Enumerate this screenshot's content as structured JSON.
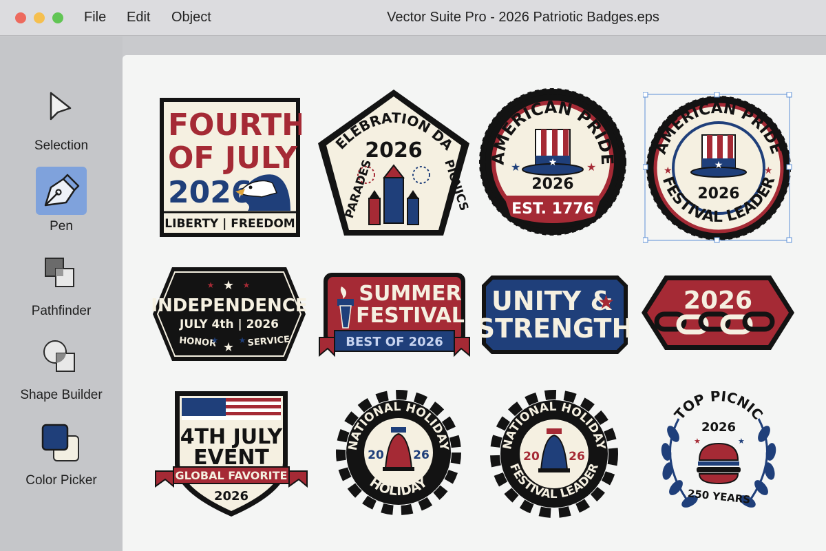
{
  "window": {
    "title": "Vector Suite Pro - 2026 Patriotic Badges.eps"
  },
  "menu": {
    "file": "File",
    "edit": "Edit",
    "object": "Object"
  },
  "tools": [
    {
      "label": "Selection",
      "icon": "arrow-cursor-icon",
      "active": false
    },
    {
      "label": "Pen",
      "icon": "pen-nib-icon",
      "active": true
    },
    {
      "label": "Pathfinder",
      "icon": "pathfinder-icon",
      "active": false
    },
    {
      "label": "Shape Builder",
      "icon": "shape-builder-icon",
      "active": false
    },
    {
      "label": "Color Picker",
      "icon": "color-swatch-icon",
      "active": false
    }
  ],
  "colors": {
    "red": "#a52a35",
    "navy": "#1f3f7a",
    "black": "#131313",
    "cream": "#f5f0e1",
    "selection": "#5b8fd6",
    "active_tool": "#7fa2dc"
  },
  "badges": {
    "b1": {
      "line1": "FOURTH",
      "line2": "OF JULY",
      "year": "2026",
      "bottom": "LIBERTY | FREEDOM"
    },
    "b2": {
      "arc": "CELEBRATION DAY",
      "year": "2026",
      "left": "PARADES",
      "right": "PICNICS"
    },
    "b3": {
      "arc": "AMERICAN PRIDE",
      "year": "2026",
      "banner": "EST. 1776"
    },
    "b4": {
      "arc_top": "AMERICAN PRIDE",
      "year": "2026",
      "arc_bottom": "FESTIVAL LEADER",
      "selected": true
    },
    "b5": {
      "title": "INDEPENDENCE",
      "sub": "JULY 4th | 2026",
      "left": "HONOR",
      "right": "SERVICE"
    },
    "b6": {
      "line1": "SUMMER",
      "line2": "FESTIVAL",
      "ribbon": "BEST OF 2026"
    },
    "b7": {
      "line1": "UNITY &",
      "line2": "STRENGTH"
    },
    "b8": {
      "year": "2026"
    },
    "b9": {
      "line1": "4TH JULY",
      "line2": "EVENT",
      "ribbon": "GLOBAL FAVORITE",
      "year": "2026"
    },
    "b10": {
      "arc": "NATIONAL HOLIDAY",
      "left": "20",
      "right": "26",
      "bottom": "HOLIDAY"
    },
    "b11": {
      "arc": "NATIONAL HOLIDAY",
      "left": "20",
      "right": "26",
      "bottom": "FESTIVAL LEADER"
    },
    "b12": {
      "arc": "TOP PICNIC",
      "year": "2026",
      "bottom": "250 YEARS"
    }
  }
}
